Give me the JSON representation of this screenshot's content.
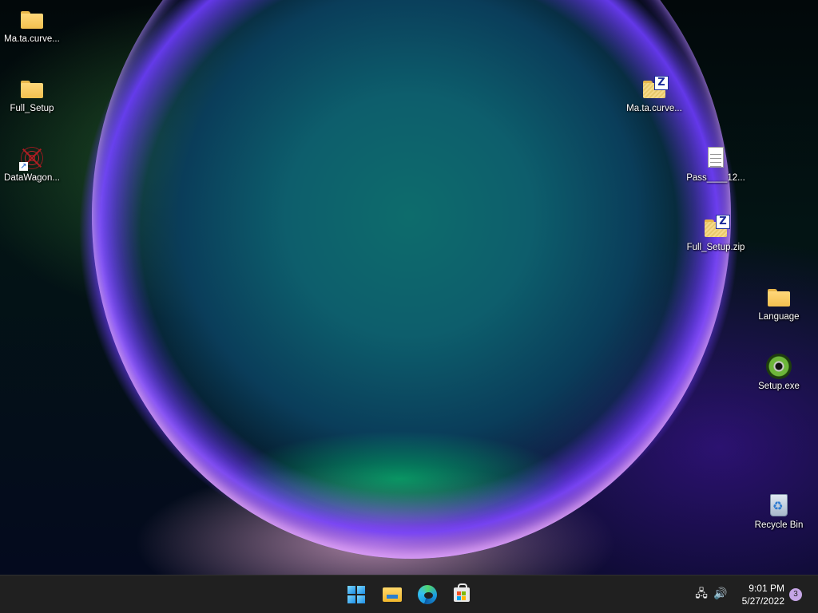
{
  "desktop": {
    "left_icons": [
      {
        "label": "Ma.ta.curve...",
        "type": "folder"
      },
      {
        "label": "Full_Setup",
        "type": "folder"
      },
      {
        "label": "DataWagon...",
        "type": "shortcut"
      }
    ],
    "right_icons": [
      {
        "label": "Ma.ta.curve...",
        "type": "zip"
      },
      {
        "label": "Pass____12...",
        "type": "text-file"
      },
      {
        "label": "Full_Setup.zip",
        "type": "zip"
      },
      {
        "label": "Language",
        "type": "folder"
      },
      {
        "label": "Setup.exe",
        "type": "exe"
      },
      {
        "label": "Recycle Bin",
        "type": "recycle-bin"
      }
    ]
  },
  "taskbar": {
    "pinned": [
      {
        "name": "start-button",
        "icon": "windows-logo-icon"
      },
      {
        "name": "file-explorer-button",
        "icon": "folder-icon"
      },
      {
        "name": "edge-button",
        "icon": "edge-browser-icon"
      },
      {
        "name": "store-button",
        "icon": "store-bag-icon"
      }
    ],
    "tray": {
      "time": "9:01 PM",
      "date": "5/27/2022",
      "notification_count": "3"
    }
  },
  "colors": {
    "taskbar_bg": "#202020",
    "folder_yellow": "#f3c04f",
    "notification_badge": "#c6a6e6"
  }
}
